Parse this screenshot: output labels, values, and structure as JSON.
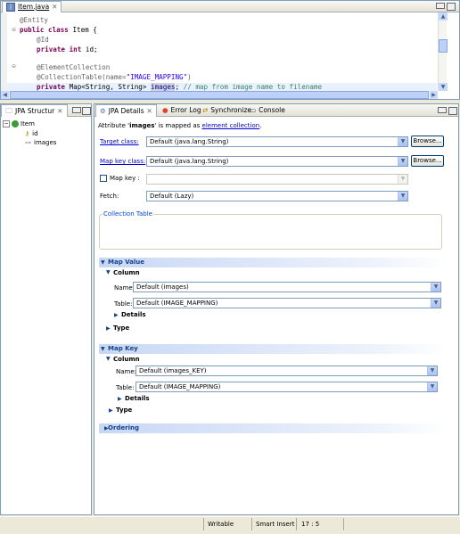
{
  "editor": {
    "tab_title": "Item.java",
    "lines": {
      "l1": "@Entity",
      "l2_kw": "public class",
      "l2_rest": " Item {",
      "l3": "@Id",
      "l4_kw": "private int",
      "l4_rest": " id;",
      "l5": "@ElementCollection",
      "l6_a": "@CollectionTable(name=",
      "l6_str": "\"IMAGE_MAPPING\"",
      "l6_b": ")",
      "l7_kw": "private",
      "l7_a": " Map<String, String> ",
      "l7_fld": "images",
      "l7_b": "; ",
      "l7_cmt": "// map from image name to filename"
    }
  },
  "structure": {
    "tab_title": "JPA Structur",
    "root": "Item",
    "children": [
      "id",
      "images"
    ]
  },
  "details": {
    "tabs": [
      "JPA Details",
      "Error Log",
      "Synchronize",
      "Console"
    ],
    "attribute_prefix": "Attribute '",
    "attribute_name": "images",
    "attribute_mid": "' is mapped as ",
    "attribute_link": "element collection",
    "attribute_end": ".",
    "target_class_label": "Target class:",
    "target_class_value": "Default (java.lang.String)",
    "browse_label": "Browse...",
    "map_key_class_label": "Map key class:",
    "map_key_class_value": "Default (java.lang.String)",
    "map_key_label": "Map key :",
    "map_key_value": "",
    "fetch_label": "Fetch:",
    "fetch_value": "Default (Lazy)",
    "collection_table_label": "Collection Table",
    "map_value": {
      "title": "Map Value",
      "column_title": "Column",
      "name_label": "Name:",
      "name_value": "Default (images)",
      "table_label": "Table:",
      "table_value": "Default (IMAGE_MAPPING)",
      "details_label": "Details",
      "type_label": "Type"
    },
    "map_key_section": {
      "title": "Map Key",
      "column_title": "Column",
      "name_label": "Name:",
      "name_value": "Default (images_KEY)",
      "table_label": "Table:",
      "table_value": "Default (IMAGE_MAPPING)",
      "details_label": "Details",
      "type_label": "Type"
    },
    "ordering_title": "Ordering"
  },
  "status": {
    "writable": "Writable",
    "insert_mode": "Smart Insert",
    "position": "17 : 5"
  },
  "colors": {
    "section_text": "#15428b",
    "keyword": "#7f0055",
    "string": "#2a00ff",
    "comment": "#3f7f5f"
  }
}
